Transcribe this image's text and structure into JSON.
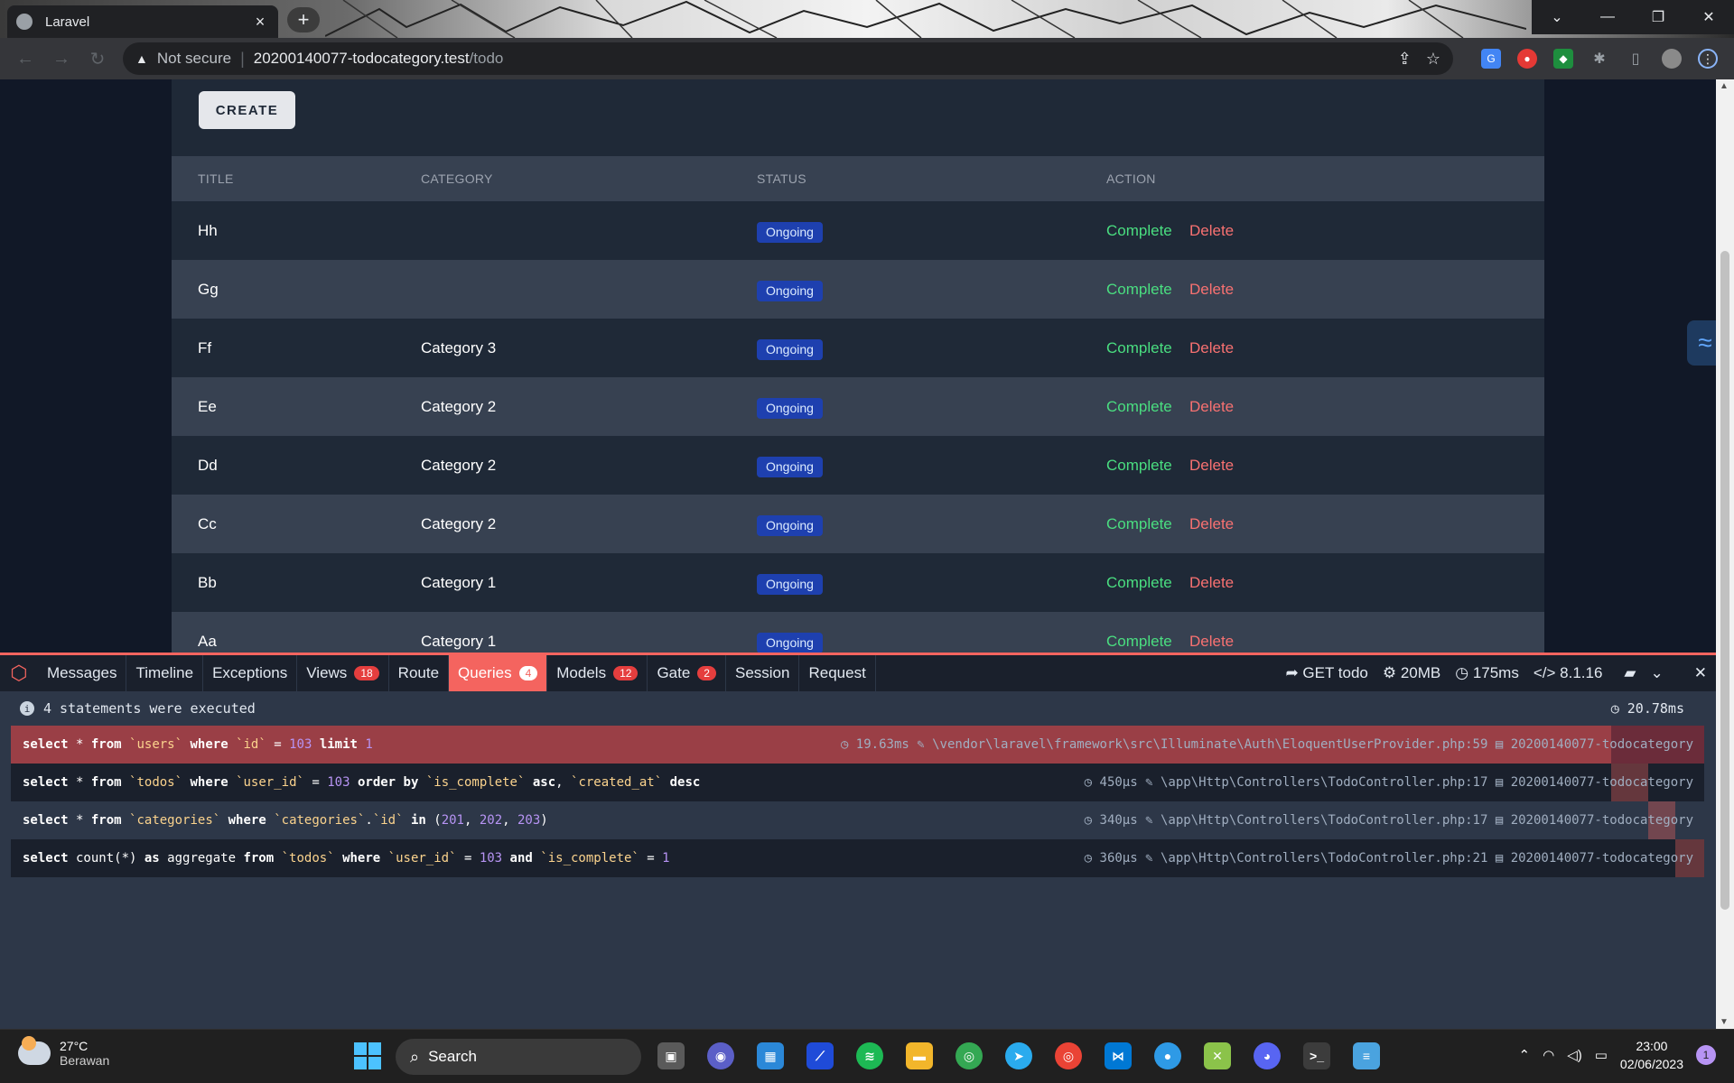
{
  "browser": {
    "tab_title": "Laravel",
    "new_tab": "+",
    "security_label": "Not secure",
    "url_host": "20200140077-todocategory.test",
    "url_path": "/todo"
  },
  "page": {
    "create_label": "CREATE",
    "columns": [
      "TITLE",
      "CATEGORY",
      "STATUS",
      "ACTION"
    ],
    "rows": [
      {
        "title": "Hh",
        "category": "",
        "status": "Ongoing",
        "complete": "Complete",
        "delete": "Delete"
      },
      {
        "title": "Gg",
        "category": "",
        "status": "Ongoing",
        "complete": "Complete",
        "delete": "Delete"
      },
      {
        "title": "Ff",
        "category": "Category 3",
        "status": "Ongoing",
        "complete": "Complete",
        "delete": "Delete"
      },
      {
        "title": "Ee",
        "category": "Category 2",
        "status": "Ongoing",
        "complete": "Complete",
        "delete": "Delete"
      },
      {
        "title": "Dd",
        "category": "Category 2",
        "status": "Ongoing",
        "complete": "Complete",
        "delete": "Delete"
      },
      {
        "title": "Cc",
        "category": "Category 2",
        "status": "Ongoing",
        "complete": "Complete",
        "delete": "Delete"
      },
      {
        "title": "Bb",
        "category": "Category 1",
        "status": "Ongoing",
        "complete": "Complete",
        "delete": "Delete"
      },
      {
        "title": "Aa",
        "category": "Category 1",
        "status": "Ongoing",
        "complete": "Complete",
        "delete": "Delete"
      }
    ]
  },
  "debugbar": {
    "tabs": [
      {
        "label": "Messages",
        "count": ""
      },
      {
        "label": "Timeline",
        "count": ""
      },
      {
        "label": "Exceptions",
        "count": ""
      },
      {
        "label": "Views",
        "count": "18"
      },
      {
        "label": "Route",
        "count": ""
      },
      {
        "label": "Queries",
        "count": "4",
        "active": true
      },
      {
        "label": "Models",
        "count": "12"
      },
      {
        "label": "Gate",
        "count": "2"
      },
      {
        "label": "Session",
        "count": ""
      },
      {
        "label": "Request",
        "count": ""
      }
    ],
    "request": "GET todo",
    "memory": "20MB",
    "time": "175ms",
    "php_version": "8.1.16",
    "statements_text": "4 statements were executed",
    "total_time": "20.78ms",
    "queries": [
      {
        "parts": [
          [
            "kw",
            "select"
          ],
          [
            "t",
            " * "
          ],
          [
            "kw",
            "from"
          ],
          [
            "t",
            " "
          ],
          [
            "str",
            "`users`"
          ],
          [
            "t",
            " "
          ],
          [
            "kw",
            "where"
          ],
          [
            "t",
            " "
          ],
          [
            "str",
            "`id`"
          ],
          [
            "t",
            " = "
          ],
          [
            "num",
            "103"
          ],
          [
            "t",
            " "
          ],
          [
            "kw",
            "limit"
          ],
          [
            "t",
            " "
          ],
          [
            "num",
            "1"
          ]
        ],
        "duration": "19.63ms",
        "source": "\\vendor\\laravel\\framework\\src\\Illuminate\\Auth\\EloquentUserProvider.php:59",
        "connection": "20200140077-todocategory",
        "share": 0.945
      },
      {
        "parts": [
          [
            "kw",
            "select"
          ],
          [
            "t",
            " * "
          ],
          [
            "kw",
            "from"
          ],
          [
            "t",
            " "
          ],
          [
            "str",
            "`todos`"
          ],
          [
            "t",
            " "
          ],
          [
            "kw",
            "where"
          ],
          [
            "t",
            " "
          ],
          [
            "str",
            "`user_id`"
          ],
          [
            "t",
            " = "
          ],
          [
            "num",
            "103"
          ],
          [
            "t",
            " "
          ],
          [
            "kw",
            "order by"
          ],
          [
            "t",
            " "
          ],
          [
            "str",
            "`is_complete`"
          ],
          [
            "t",
            " "
          ],
          [
            "kw",
            "asc"
          ],
          [
            "t",
            ", "
          ],
          [
            "str",
            "`created_at`"
          ],
          [
            "t",
            " "
          ],
          [
            "kw",
            "desc"
          ]
        ],
        "duration": "450μs",
        "source": "\\app\\Http\\Controllers\\TodoController.php:17",
        "connection": "20200140077-todocategory",
        "share": 0.022
      },
      {
        "parts": [
          [
            "kw",
            "select"
          ],
          [
            "t",
            " * "
          ],
          [
            "kw",
            "from"
          ],
          [
            "t",
            " "
          ],
          [
            "str",
            "`categories`"
          ],
          [
            "t",
            " "
          ],
          [
            "kw",
            "where"
          ],
          [
            "t",
            " "
          ],
          [
            "str",
            "`categories`"
          ],
          [
            "t",
            "."
          ],
          [
            "str",
            "`id`"
          ],
          [
            "t",
            " "
          ],
          [
            "kw",
            "in"
          ],
          [
            "t",
            " ("
          ],
          [
            "num",
            "201"
          ],
          [
            "t",
            ", "
          ],
          [
            "num",
            "202"
          ],
          [
            "t",
            ", "
          ],
          [
            "num",
            "203"
          ],
          [
            "t",
            ")"
          ]
        ],
        "duration": "340μs",
        "source": "\\app\\Http\\Controllers\\TodoController.php:17",
        "connection": "20200140077-todocategory",
        "share": 0.016
      },
      {
        "parts": [
          [
            "kw",
            "select"
          ],
          [
            "t",
            " count(*) "
          ],
          [
            "kw",
            "as"
          ],
          [
            "t",
            " aggregate "
          ],
          [
            "kw",
            "from"
          ],
          [
            "t",
            " "
          ],
          [
            "str",
            "`todos`"
          ],
          [
            "t",
            " "
          ],
          [
            "kw",
            "where"
          ],
          [
            "t",
            " "
          ],
          [
            "str",
            "`user_id`"
          ],
          [
            "t",
            " = "
          ],
          [
            "num",
            "103"
          ],
          [
            "t",
            " "
          ],
          [
            "kw",
            "and"
          ],
          [
            "t",
            " "
          ],
          [
            "str",
            "`is_complete`"
          ],
          [
            "t",
            " = "
          ],
          [
            "num",
            "1"
          ]
        ],
        "duration": "360μs",
        "source": "\\app\\Http\\Controllers\\TodoController.php:21",
        "connection": "20200140077-todocategory",
        "share": 0.017
      }
    ]
  },
  "taskbar": {
    "temperature": "27°C",
    "weather": "Berawan",
    "search_placeholder": "Search",
    "time": "23:00",
    "date": "02/06/2023",
    "notifications": "1"
  }
}
